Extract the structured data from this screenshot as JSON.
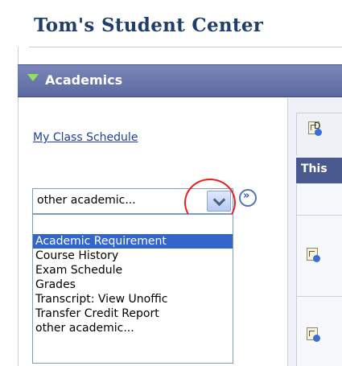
{
  "page": {
    "title": "Tom's Student Center"
  },
  "section": {
    "label": "Academics"
  },
  "links": {
    "class_schedule": "My Class Schedule"
  },
  "dropdown": {
    "selected_value": "other academic...",
    "options": [
      "Academic Requirement",
      "Course History",
      "Exam Schedule",
      "Grades",
      "Transcript: View Unoffic",
      "Transfer Credit Report",
      "other academic..."
    ],
    "highlighted_index": 0,
    "go_button_glyph": "»"
  },
  "right_panel": {
    "header_text": "This",
    "cut_link_text": "D"
  },
  "colors": {
    "title": "#1f3f6a",
    "section_bar": "#5b6aa2",
    "link": "#1f3f9c",
    "highlight": "#3366cc",
    "annotation_ring": "#e62020"
  }
}
